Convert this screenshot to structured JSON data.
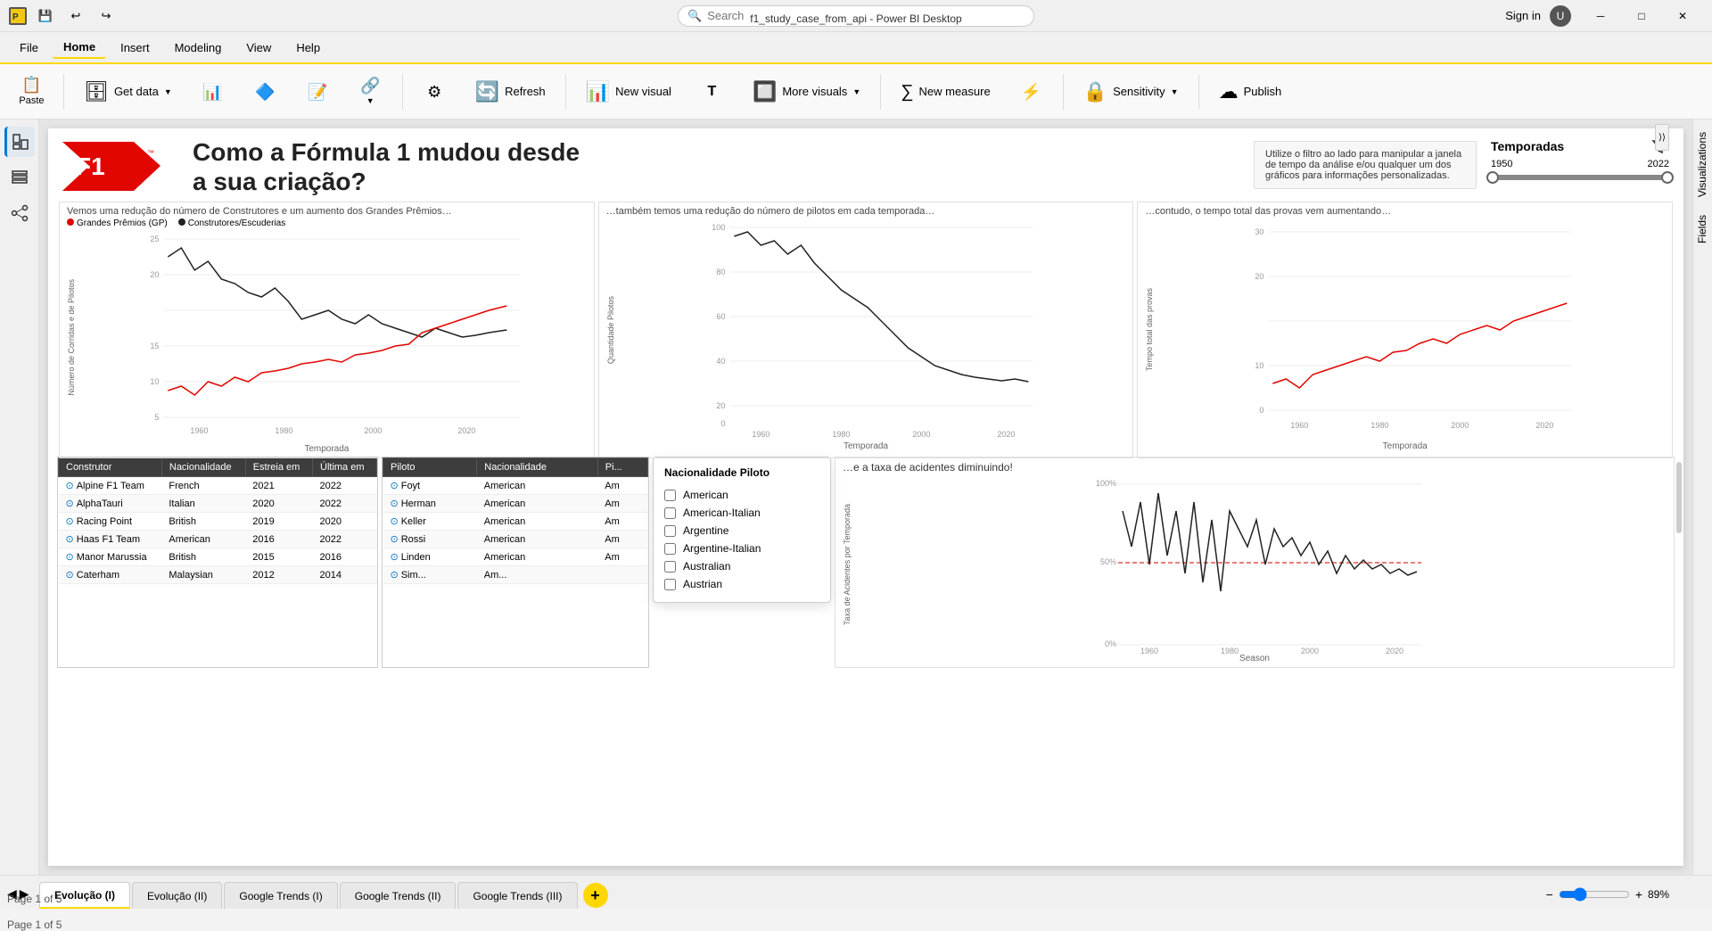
{
  "titlebar": {
    "title": "f1_study_case_from_api - Power BI Desktop",
    "search_placeholder": "Search",
    "signin": "Sign in",
    "save_icon": "💾",
    "undo_icon": "↩",
    "redo_icon": "↪"
  },
  "menubar": {
    "items": [
      "File",
      "Home",
      "Insert",
      "Modeling",
      "View",
      "Help"
    ],
    "active": "Home"
  },
  "ribbon": {
    "buttons": [
      {
        "id": "paste",
        "icon": "📋",
        "label": ""
      },
      {
        "id": "save",
        "icon": "💾",
        "label": ""
      },
      {
        "id": "get-data",
        "icon": "🗄",
        "label": "Get data"
      },
      {
        "id": "excel",
        "icon": "📊",
        "label": ""
      },
      {
        "id": "models",
        "icon": "🔷",
        "label": ""
      },
      {
        "id": "enter-data",
        "icon": "📝",
        "label": ""
      },
      {
        "id": "datasource",
        "icon": "🔗",
        "label": ""
      },
      {
        "id": "transform",
        "icon": "⚙",
        "label": ""
      },
      {
        "id": "refresh",
        "icon": "🔄",
        "label": "Refresh"
      },
      {
        "id": "new-visual",
        "icon": "📊",
        "label": "New visual"
      },
      {
        "id": "text-box",
        "icon": "T",
        "label": ""
      },
      {
        "id": "more-visuals",
        "icon": "🔲",
        "label": "More visuals"
      },
      {
        "id": "new-measure",
        "icon": "∑",
        "label": "New measure"
      },
      {
        "id": "quick-measure",
        "icon": "⚡",
        "label": ""
      },
      {
        "id": "sensitivity",
        "icon": "🔒",
        "label": "Sensitivity"
      },
      {
        "id": "publish",
        "icon": "☁",
        "label": "Publish"
      }
    ]
  },
  "sidebar": {
    "icons": [
      "📊",
      "📋",
      "🔷"
    ]
  },
  "canvas": {
    "title_main": "Como a Fórmula 1 mudou desde",
    "title_sub": "a sua criação?",
    "filter_text": "Utilize o filtro ao lado para manipular a janela de tempo da análise e/ou qualquer um dos gráficos para informações personalizadas.",
    "subtitle1": "Vemos uma redução do número de Construtores e um aumento dos Grandes Prêmios…",
    "subtitle2": "…também temos uma redução do número de pilotos em cada temporada…",
    "subtitle3": "…contudo, o tempo total das provas vem aumentando…",
    "subtitle4": "…e a taxa de acidentes diminuindo!",
    "legend1a": "Grandes Prêmios (GP)",
    "legend1b": "Construtores/Escuderias",
    "chart1_yaxis": "Número de Corridas e de Pilotos",
    "chart1_xaxis": "Temporada",
    "chart2_yaxis": "Quantidade Pilotos",
    "chart2_xaxis": "Temporada",
    "chart3_yaxis": "Tempo total das provas",
    "chart3_xaxis": "Temporada",
    "chart4_yaxis": "Taxa de Acidentes por Temporada",
    "chart4_xaxis": "Season",
    "seasons_title": "Temporadas",
    "season_start": "1950",
    "season_end": "2022",
    "table1_headers": [
      "Construtor",
      "Nacionalidade",
      "Estreia em",
      "Última em"
    ],
    "table1_rows": [
      [
        "Alpine F1 Team",
        "French",
        "2021",
        "2022"
      ],
      [
        "AlphaTauri",
        "Italian",
        "2020",
        "2022"
      ],
      [
        "Racing Point",
        "British",
        "2019",
        "2020"
      ],
      [
        "Haas F1 Team",
        "American",
        "2016",
        "2022"
      ],
      [
        "Manor Marussia",
        "British",
        "2015",
        "2016"
      ],
      [
        "Caterham",
        "Malaysian",
        "2012",
        "2014"
      ]
    ],
    "table2_headers": [
      "Piloto",
      "Nacionalidade",
      "Pi..."
    ],
    "table2_rows": [
      [
        "Foyt",
        "American",
        "Am"
      ],
      [
        "Herman",
        "American",
        "Am"
      ],
      [
        "Keller",
        "American",
        "Am"
      ],
      [
        "Rossi",
        "American",
        "Am"
      ],
      [
        "Linden",
        "American",
        "Am"
      ],
      [
        "Sim...",
        "Am...",
        ""
      ]
    ],
    "filter_dropdown": {
      "title": "Nacionalidade Piloto",
      "items": [
        "American",
        "American-Italian",
        "Argentine",
        "Argentine-Italian",
        "Australian",
        "Austrian"
      ]
    }
  },
  "tabs": {
    "items": [
      "Evolução (I)",
      "Evolução (II)",
      "Google Trends (I)",
      "Google Trends (II)",
      "Google Trends (III)"
    ],
    "active": "Evolução (I)"
  },
  "statusbar": {
    "page": "Page 1 of 5",
    "zoom": "89%"
  },
  "right_sidebar": {
    "panels": [
      "Visualizations",
      "Fields"
    ]
  }
}
